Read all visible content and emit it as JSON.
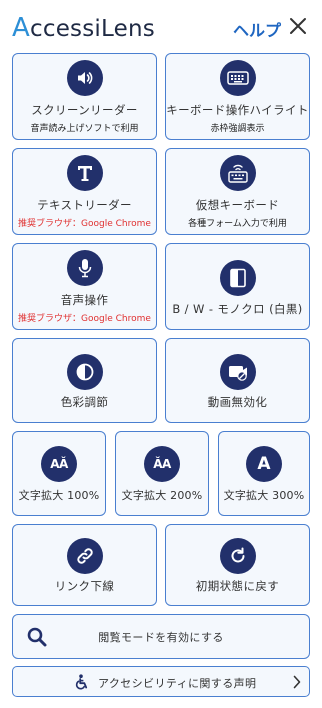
{
  "header": {
    "logo_initial": "A",
    "logo_rest": "ccessiLens",
    "help": "ヘルプ",
    "close_icon": "close-icon"
  },
  "colors": {
    "accent": "#2d8fd6",
    "border": "#4a7fd0",
    "icon_bg": "#22306b",
    "warning": "#e03131",
    "card_bg": "#f4f8fd"
  },
  "tiles": {
    "screen_reader": {
      "icon": "speaker-icon",
      "label": "スクリーンリーダー",
      "sub": "音声読み上げソフトで利用"
    },
    "keyboard_highlight": {
      "icon": "keyboard-icon",
      "label": "キーボード操作ハイライト",
      "sub": "赤枠強調表示"
    },
    "text_reader": {
      "icon": "text-t-icon",
      "label": "テキストリーダー",
      "sub": "推奨ブラウザ：Google Chrome"
    },
    "virtual_keyboard": {
      "icon": "wireless-keyboard-icon",
      "label": "仮想キーボード",
      "sub": "各種フォーム入力で利用"
    },
    "voice_control": {
      "icon": "microphone-icon",
      "label": "音声操作",
      "sub": "推奨ブラウザ：Google Chrome"
    },
    "monochrome": {
      "icon": "monochrome-icon",
      "label": "B / W - モノクロ (白黒)"
    },
    "color_adjust": {
      "icon": "contrast-icon",
      "label": "色彩調節"
    },
    "disable_video": {
      "icon": "video-off-icon",
      "label": "動画無効化"
    },
    "font_100": {
      "icon": "font-size-icon",
      "label": "文字拡大 100%",
      "glyph": "AǍ"
    },
    "font_200": {
      "icon": "font-size-icon",
      "label": "文字拡大 200%",
      "glyph": "ǍA"
    },
    "font_300": {
      "icon": "font-size-icon",
      "label": "文字拡大 300%",
      "glyph": "A"
    },
    "underline_links": {
      "icon": "link-icon",
      "label": "リンク下線"
    },
    "reset": {
      "icon": "reset-icon",
      "label": "初期状態に戻す"
    }
  },
  "browse_mode": {
    "icon": "search-icon",
    "label": "閲覧モードを有効にする"
  },
  "statement": {
    "icon": "accessibility-icon",
    "label": "アクセシビリティに関する声明",
    "chevron": "chevron-right-icon"
  }
}
